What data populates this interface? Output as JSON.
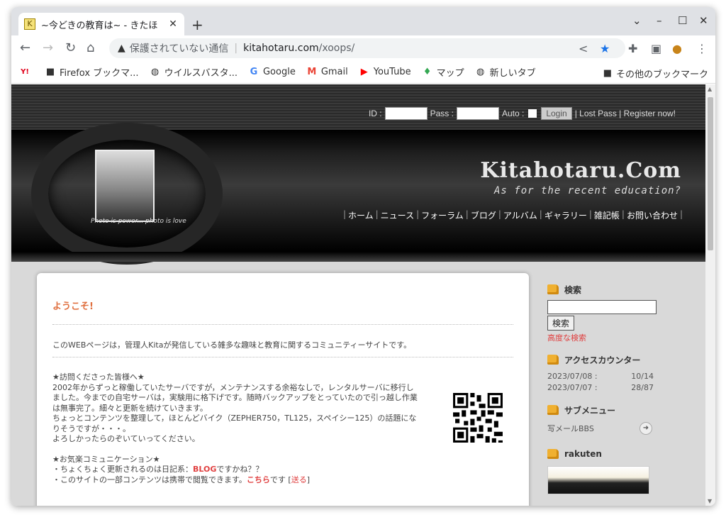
{
  "browser": {
    "tab_title": "~今どきの教育は~ - きたほ",
    "favicon": "K",
    "url_warning": "保護されていない通信",
    "url_host": "kitahotaru.com",
    "url_path": "/xoops/"
  },
  "bookmarks": [
    {
      "label": "",
      "icon": "yahoo-icon"
    },
    {
      "label": "Firefox ブックマ...",
      "icon": "folder-icon"
    },
    {
      "label": "ウイルスバスタ...",
      "icon": "globe-icon"
    },
    {
      "label": "Google",
      "icon": "google-icon"
    },
    {
      "label": "Gmail",
      "icon": "gmail-icon"
    },
    {
      "label": "YouTube",
      "icon": "youtube-icon"
    },
    {
      "label": "マップ",
      "icon": "maps-icon"
    },
    {
      "label": "新しいタブ",
      "icon": "globe-icon"
    }
  ],
  "bookmarks_other": "その他のブックマーク",
  "login": {
    "id_label": "ID :",
    "pass_label": "Pass :",
    "auto_label": "Auto :",
    "login_button": "Login",
    "lost_pass": "| Lost Pass | Register now!"
  },
  "header": {
    "title": "Kitahotaru.Com",
    "subtitle": "As for the recent education?",
    "photo_caption": "Photo is power... photo is love",
    "menu": [
      "ホーム",
      "ニュース",
      "フォーラム",
      "ブログ",
      "アルバム",
      "ギャラリー",
      "雑記帳",
      "お問い合わせ"
    ]
  },
  "main": {
    "welcome": "ようこそ!",
    "intro": "このWEBページは，管理人Kitaが発信している雑多な趣味と教育に関するコミュニティーサイトです。",
    "visit_heading": "★訪問くださった皆様へ★",
    "visit_lines": [
      "2002年からずっと稼働していたサーバですが，メンテナンスする余裕なしで，レンタルサーバに移行し",
      "ました。今までの自宅サーバは，実験用に格下げです。随時バックアップをとっていたので引っ越し作業",
      "は無事完了。細々と更新を続けていきます。",
      "ちょっとコンテンツを整理して，ほとんどバイク（ZEPHER750，TL125，スペイシー125）の話題にな",
      "りそうですが・・・。",
      "よろしかったらのぞいていってください。"
    ],
    "comm_heading": "★お気楽コミュニケーション★",
    "comm_line1_pre": "・ちょくちょく更新されるのは日記系：",
    "comm_line1_link": "BLOG",
    "comm_line1_post": "ですかね？？",
    "comm_line2_pre": "・このサイトの一部コンテンツは携帯で閲覧できます。",
    "comm_line2_link": "こちら",
    "comm_line2_mid": "です [",
    "comm_line2_send": "送る",
    "comm_line2_end": "]"
  },
  "sidebar": {
    "search_title": "検索",
    "search_button": "検索",
    "advanced": "高度な検索",
    "counter_title": "アクセスカウンター",
    "counter": [
      {
        "date": "2023/07/08 :",
        "value": "10/14"
      },
      {
        "date": "2023/07/07 :",
        "value": "28/87"
      }
    ],
    "submenu_title": "サブメニュー",
    "submenu_item": "写メールBBS",
    "rakuten_title": "rakuten"
  }
}
